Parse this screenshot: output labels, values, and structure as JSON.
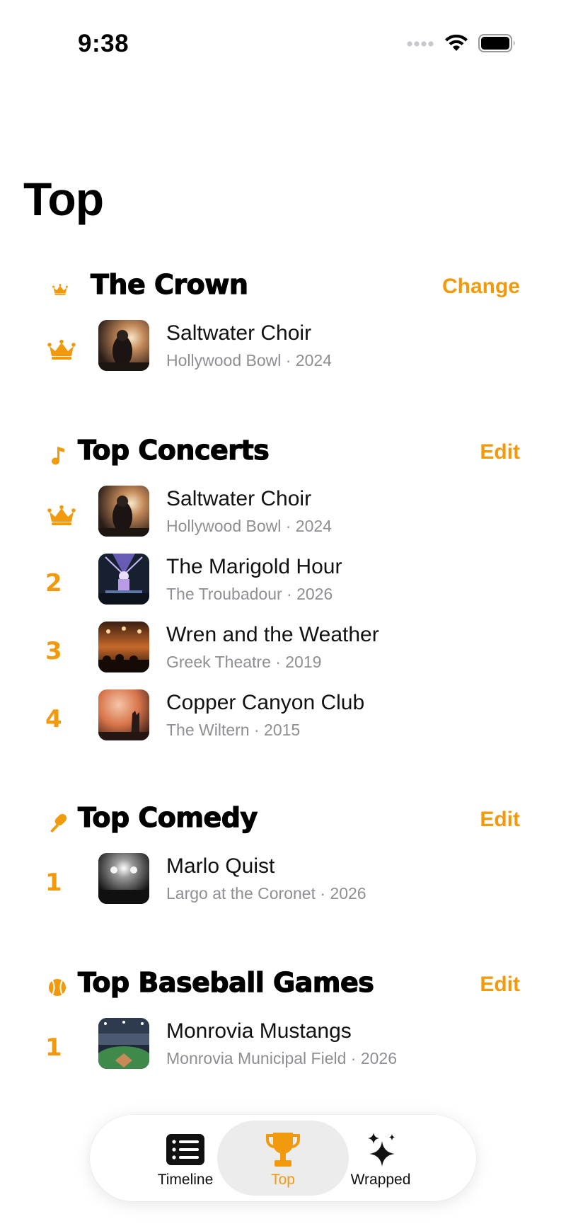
{
  "status": {
    "time": "9:38",
    "icons": [
      "cellular-signal-icon",
      "wifi-icon",
      "battery-icon"
    ]
  },
  "page": {
    "title": "Top"
  },
  "accent_color": "#F29A0E",
  "sections": {
    "crown": {
      "title": "The Crown",
      "icon": "crown-icon",
      "action": "Change",
      "items": [
        {
          "rank": "crown",
          "title": "Saltwater Choir",
          "subtitle": "Hollywood Bowl · 2024"
        }
      ]
    },
    "concerts": {
      "title": "Top Concerts",
      "icon": "music-note-icon",
      "action": "Edit",
      "items": [
        {
          "rank": "crown",
          "title": "Saltwater Choir",
          "subtitle": "Hollywood Bowl · 2024"
        },
        {
          "rank": "2",
          "title": "The Marigold Hour",
          "subtitle": "The Troubadour · 2026"
        },
        {
          "rank": "3",
          "title": "Wren and the Weather",
          "subtitle": "Greek Theatre · 2019"
        },
        {
          "rank": "4",
          "title": "Copper Canyon Club",
          "subtitle": "The Wiltern · 2015"
        }
      ]
    },
    "comedy": {
      "title": "Top Comedy",
      "icon": "microphone-icon",
      "action": "Edit",
      "items": [
        {
          "rank": "1",
          "title": "Marlo Quist",
          "subtitle": "Largo at the Coronet · 2026"
        }
      ]
    },
    "baseball": {
      "title": "Top Baseball Games",
      "icon": "baseball-icon",
      "action": "Edit",
      "items": [
        {
          "rank": "1",
          "title": "Monrovia Mustangs",
          "subtitle": "Monrovia Municipal Field · 2026"
        }
      ]
    }
  },
  "tabbar": {
    "tabs": [
      {
        "label": "Timeline",
        "icon": "list-icon",
        "active": false
      },
      {
        "label": "Top",
        "icon": "trophy-icon",
        "active": true
      },
      {
        "label": "Wrapped",
        "icon": "sparkles-icon",
        "active": false
      }
    ]
  }
}
